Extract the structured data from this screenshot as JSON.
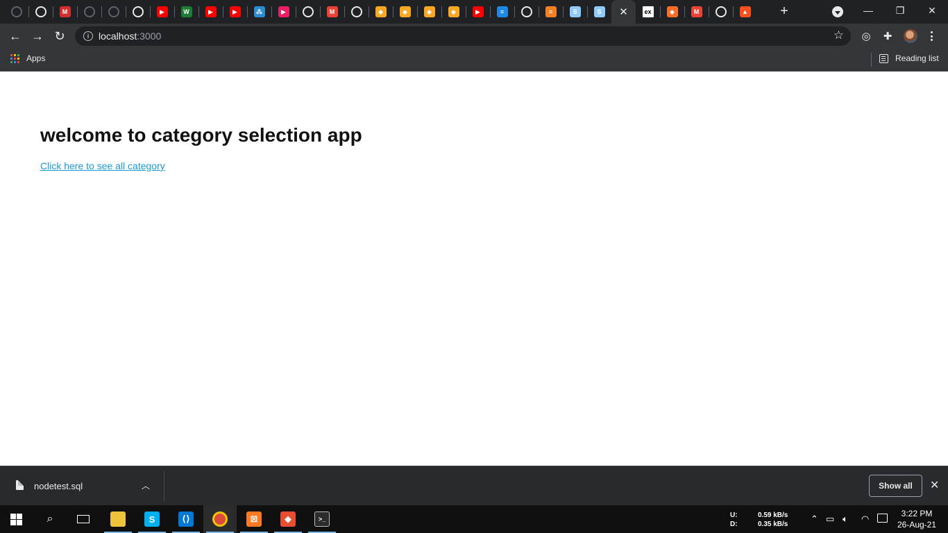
{
  "browser": {
    "tabs": [
      {
        "icon": "github-icon",
        "color": "#3a3b3f",
        "glyph": ""
      },
      {
        "icon": "globe-icon",
        "color": "#e8eaed",
        "glyph": ""
      },
      {
        "icon": "m-logo-icon",
        "color": "#d32f2f",
        "glyph": "M"
      },
      {
        "icon": "github-icon",
        "color": "#3a3b3f",
        "glyph": ""
      },
      {
        "icon": "github-icon",
        "color": "#3a3b3f",
        "glyph": ""
      },
      {
        "icon": "globe-icon",
        "color": "#e8eaed",
        "glyph": ""
      },
      {
        "icon": "youtube-icon",
        "color": "#ff0000",
        "glyph": "▶"
      },
      {
        "icon": "w-logo-icon",
        "color": "#1e7b34",
        "glyph": "W"
      },
      {
        "icon": "youtube-icon",
        "color": "#ff0000",
        "glyph": "▶"
      },
      {
        "icon": "youtube-icon",
        "color": "#ff0000",
        "glyph": "▶"
      },
      {
        "icon": "dots-logo-icon",
        "color": "#2d8ccf",
        "glyph": "⁂"
      },
      {
        "icon": "media-icon",
        "color": "#e91e63",
        "glyph": "▶"
      },
      {
        "icon": "globe-icon",
        "color": "#e8eaed",
        "glyph": ""
      },
      {
        "icon": "gmail-icon",
        "color": "#ea4335",
        "glyph": "M"
      },
      {
        "icon": "chrome-icon",
        "color": "#e8eaed",
        "glyph": ""
      },
      {
        "icon": "shield-logo-icon",
        "color": "#f9a825",
        "glyph": "◆"
      },
      {
        "icon": "shield-logo-icon",
        "color": "#f9a825",
        "glyph": "◆"
      },
      {
        "icon": "shield-logo-icon",
        "color": "#f9a825",
        "glyph": "◆"
      },
      {
        "icon": "shield-logo-icon",
        "color": "#f9a825",
        "glyph": "◆"
      },
      {
        "icon": "youtube-icon",
        "color": "#ff0000",
        "glyph": "▶"
      },
      {
        "icon": "database-icon",
        "color": "#1e88e5",
        "glyph": "≡"
      },
      {
        "icon": "globe-icon",
        "color": "#e8eaed",
        "glyph": ""
      },
      {
        "icon": "stackoverflow-icon",
        "color": "#f48024",
        "glyph": "≡"
      },
      {
        "icon": "sqlite-icon",
        "color": "#90caf9",
        "glyph": "S"
      },
      {
        "icon": "sqlite-icon",
        "color": "#90caf9",
        "glyph": "S"
      },
      {
        "icon": "close-tab-icon",
        "color": "",
        "glyph": "✕",
        "active": true
      },
      {
        "icon": "express-icon",
        "color": "#ffffff",
        "glyph": "ex"
      },
      {
        "icon": "gitlab-icon",
        "color": "#fc6d26",
        "glyph": "◆"
      },
      {
        "icon": "gmail-icon",
        "color": "#ea4335",
        "glyph": "M"
      },
      {
        "icon": "chrome-icon",
        "color": "#e8eaed",
        "glyph": ""
      },
      {
        "icon": "triangle-logo-icon",
        "color": "#f4511e",
        "glyph": "▲"
      }
    ],
    "address": {
      "host": "localhost",
      "port": ":3000"
    },
    "bookmarks": {
      "apps_label": "Apps",
      "reading_list_label": "Reading list"
    }
  },
  "page": {
    "heading": "welcome to category selection app",
    "link_text": "Click here to see all category"
  },
  "downloads": {
    "file_name": "nodetest.sql",
    "show_all_label": "Show all"
  },
  "taskbar": {
    "apps": [
      {
        "name": "file-explorer-icon",
        "glyph": "",
        "color": "#f0c33c"
      },
      {
        "name": "skype-icon",
        "glyph": "S",
        "color": "#00aff0"
      },
      {
        "name": "vscode-icon",
        "glyph": "⟨⟩",
        "color": "#0078d4"
      },
      {
        "name": "chrome-icon",
        "glyph": "",
        "color": "#dd4b39",
        "active": true
      },
      {
        "name": "xampp-icon",
        "glyph": "⊠",
        "color": "#fb7a24"
      },
      {
        "name": "git-icon",
        "glyph": "◆",
        "color": "#e84e31"
      },
      {
        "name": "terminal-icon",
        "glyph": ">_",
        "color": "#2b2b2b"
      }
    ],
    "network": {
      "up_label": "U:",
      "down_label": "D:",
      "up_speed": "0.59 kB/s",
      "down_speed": "0.35 kB/s"
    },
    "time": "3:22 PM",
    "date": "26-Aug-21"
  }
}
